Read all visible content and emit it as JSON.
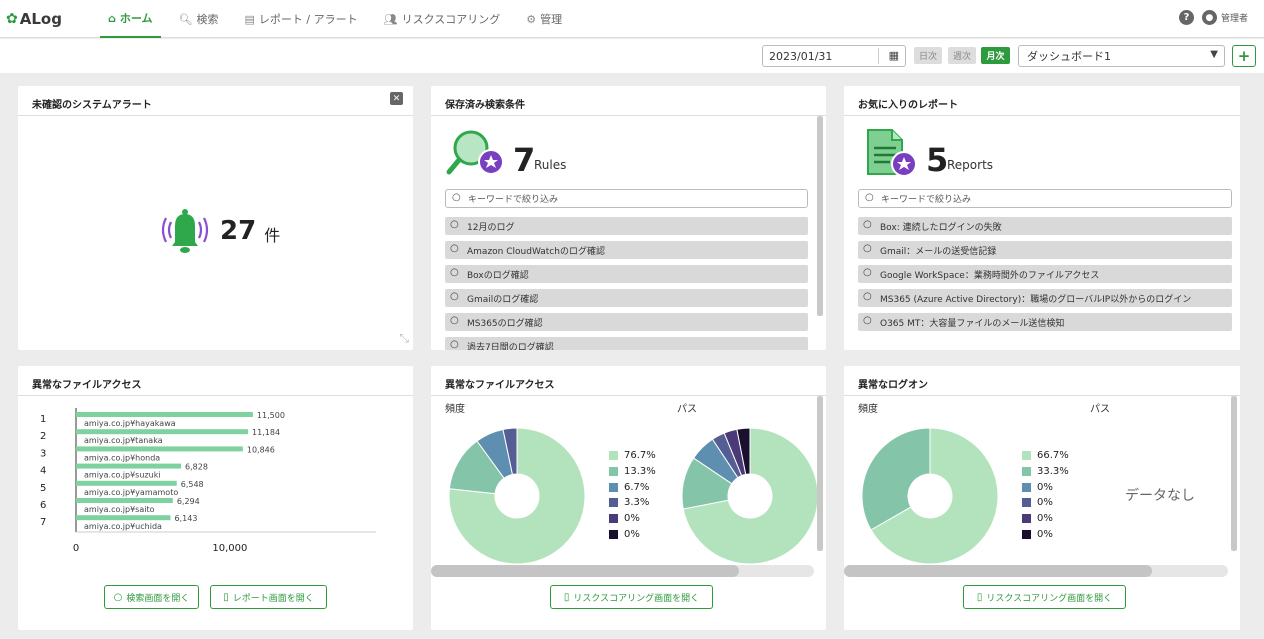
{
  "app": {
    "logo": "ALog"
  },
  "nav": {
    "items": [
      {
        "label": "ホーム",
        "icon": "home-icon",
        "active": true
      },
      {
        "label": "検索",
        "icon": "search-icon",
        "active": false
      },
      {
        "label": "レポート / アラート",
        "icon": "report-icon",
        "active": false
      },
      {
        "label": "リスクスコアリング",
        "icon": "users-icon",
        "active": false
      },
      {
        "label": "管理",
        "icon": "gear-icon",
        "active": false
      }
    ],
    "user_label": "管理者"
  },
  "toolbar": {
    "date": "2023/01/31",
    "period_buttons": [
      "日次",
      "週次",
      "月次"
    ],
    "period_selected": "月次",
    "dashboard_select": "ダッシュボード1",
    "add_label": "+"
  },
  "alerts_panel": {
    "title": "未確認のシステムアラート",
    "count": "27",
    "unit": "件"
  },
  "saved_search_panel": {
    "title": "保存済み検索条件",
    "count": "7",
    "unit": "Rules",
    "search_placeholder": "キーワードで絞り込み",
    "items": [
      "12月のログ",
      "Amazon CloudWatchのログ確認",
      "Boxのログ確認",
      "Gmailのログ確認",
      "MS365のログ確認",
      "過去7日間のログ確認"
    ]
  },
  "fav_report_panel": {
    "title": "お気に入りのレポート",
    "count": "5",
    "unit": "Reports",
    "search_placeholder": "キーワードで絞り込み",
    "items": [
      "Box: 連続したログインの失敗",
      "Gmail：メールの送受信記録",
      "Google WorkSpace：業務時間外のファイルアクセス",
      "MS365 (Azure Active Directory)：職場のグローバルIP以外からのログイン",
      "O365 MT：大容量ファイルのメール送信検知"
    ]
  },
  "file_access_bar": {
    "title": "異常なファイルアクセス",
    "open_search_label": "検索画面を開く",
    "open_report_label": "レポート画面を開く"
  },
  "file_access_donut": {
    "title": "異常なファイルアクセス",
    "freq_label": "頻度",
    "path_label": "パス",
    "legend": [
      "76.7%",
      "13.3%",
      "6.7%",
      "3.3%",
      "0%",
      "0%"
    ],
    "open_label": "リスクスコアリング画面を開く"
  },
  "logon_donut": {
    "title": "異常なログオン",
    "freq_label": "頻度",
    "path_label": "パス",
    "legend": [
      "66.7%",
      "33.3%",
      "0%",
      "0%",
      "0%",
      "0%"
    ],
    "nodata": "データなし",
    "open_label": "リスクスコアリング画面を開く"
  },
  "colors": {
    "accent": "#2e9a3e",
    "palette": [
      "#b3e3bd",
      "#84c4a8",
      "#5f8fb0",
      "#545e95",
      "#4b3a78",
      "#1a0f2e"
    ],
    "bar": "#7fd1a0",
    "bell": "#2ea84a",
    "bell_waves": "#8a4fd0"
  },
  "chart_data": [
    {
      "type": "bar",
      "orientation": "horizontal",
      "categories": [
        "amiya.co.jp¥hayakawa",
        "amiya.co.jp¥tanaka",
        "amiya.co.jp¥honda",
        "amiya.co.jp¥suzuki",
        "amiya.co.jp¥yamamoto",
        "amiya.co.jp¥saito",
        "amiya.co.jp¥uchida"
      ],
      "ranks": [
        "1",
        "2",
        "3",
        "4",
        "5",
        "6",
        "7"
      ],
      "values": [
        11500,
        11184,
        10846,
        6828,
        6548,
        6294,
        6143
      ],
      "value_labels": [
        "11,500",
        "11,184",
        "10,846",
        "6,828",
        "6,548",
        "6,294",
        "6,143"
      ],
      "xlim": [
        0,
        19500
      ],
      "xticks": [
        {
          "value": 0,
          "label": "0"
        },
        {
          "value": 10000,
          "label": "10,000"
        }
      ]
    },
    {
      "type": "pie",
      "name": "file-access-frequency",
      "values": [
        76.7,
        13.3,
        6.7,
        3.3,
        0,
        0
      ]
    },
    {
      "type": "pie",
      "name": "file-access-path",
      "values": [
        76.7,
        13.3,
        6.7,
        3.3,
        3.3,
        3.3
      ]
    },
    {
      "type": "pie",
      "name": "logon-frequency",
      "values": [
        66.7,
        33.3,
        0,
        0,
        0,
        0
      ]
    }
  ]
}
